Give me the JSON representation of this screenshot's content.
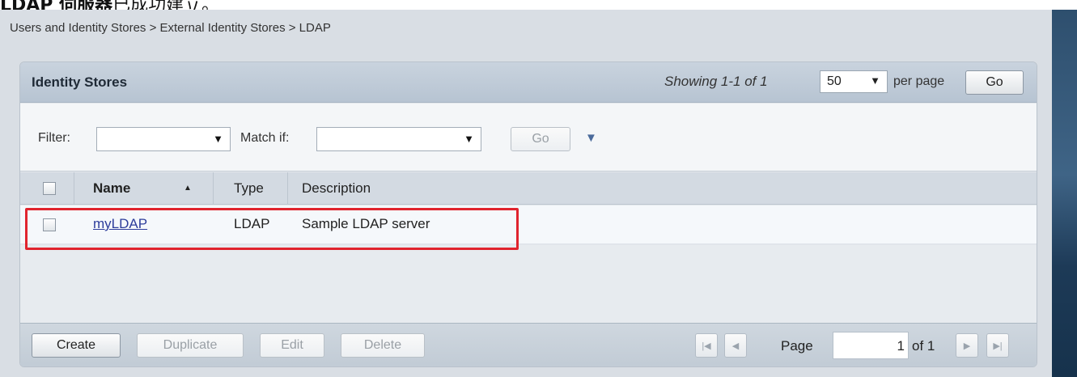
{
  "caption": {
    "bold": "LDAP 伺服器",
    "rest": "已成功建立。"
  },
  "breadcrumb": "Users and Identity Stores > External Identity Stores > LDAP",
  "panel": {
    "title": "Identity Stores",
    "showing": "Showing 1-1 of 1",
    "per_page_value": "50",
    "per_page_label": "per page",
    "go_label": "Go"
  },
  "filter": {
    "filter_label": "Filter:",
    "match_label": "Match if:",
    "go_label": "Go",
    "dropdown_arrow": "▼",
    "expand_icon": "▼"
  },
  "table": {
    "columns": [
      "Name",
      "Type",
      "Description"
    ],
    "sort_indicator": "▲",
    "rows": [
      {
        "name": "myLDAP",
        "type": "LDAP",
        "description": "Sample LDAP server"
      }
    ]
  },
  "footer": {
    "create": "Create",
    "duplicate": "Duplicate",
    "edit": "Edit",
    "delete": "Delete",
    "page_label": "Page",
    "page_value": "1",
    "of_label": "of 1",
    "first_icon": "|◀",
    "prev_icon": "◀",
    "next_icon": "▶",
    "last_icon": "▶|"
  },
  "colors": {
    "highlight": "#e0242e",
    "link": "#2d3d9b",
    "accent_strip": "#2e4f6e"
  }
}
